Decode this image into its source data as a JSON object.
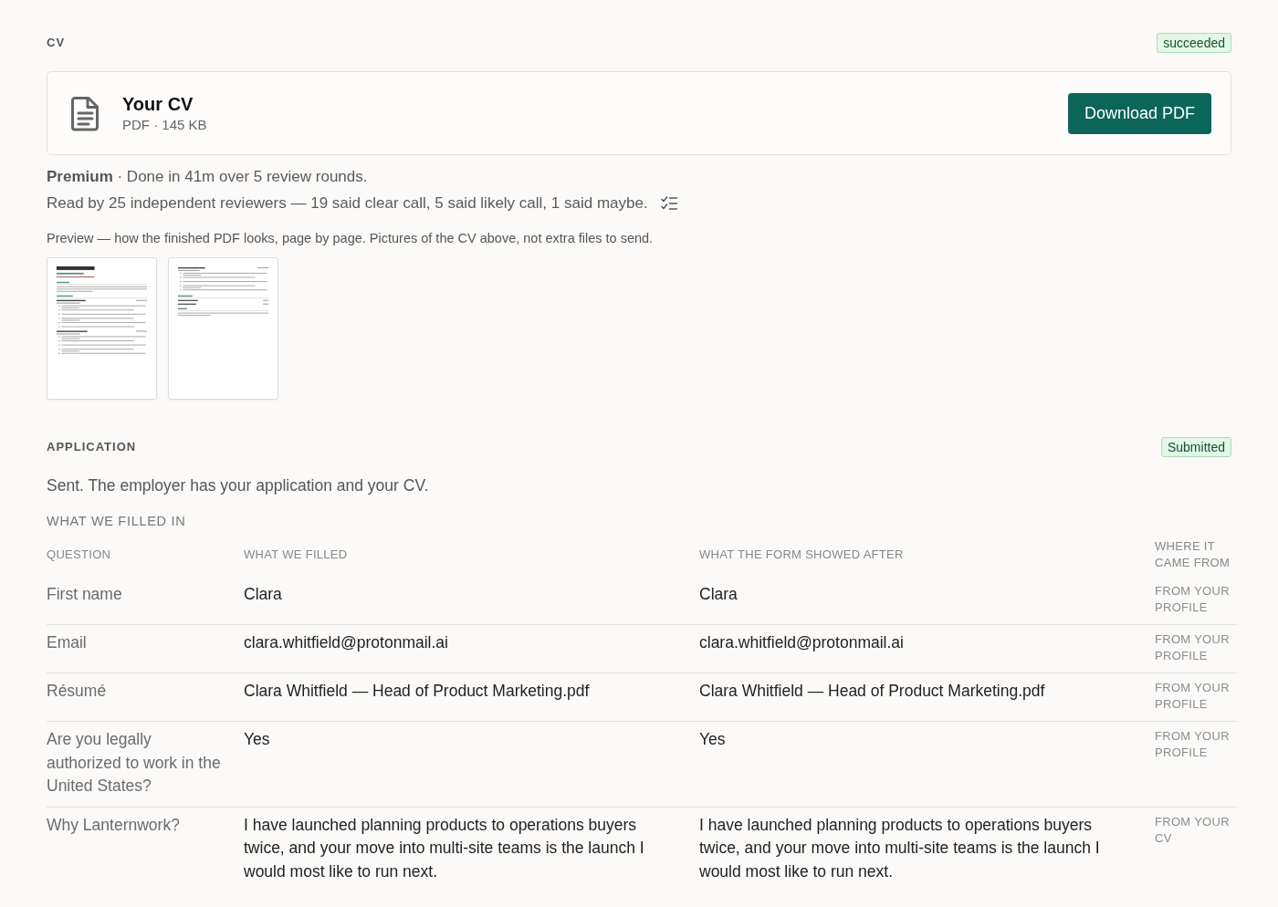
{
  "cv": {
    "heading": "CV",
    "status": {
      "label": "succeeded"
    },
    "file": {
      "title": "Your CV",
      "meta": "PDF · 145 KB",
      "action": "Download PDF"
    },
    "summary": "**Premium** · Done in 41m over 5 review rounds.",
    "reviewers": "Read by 25 independent reviewers — 19 said clear call, 5 said likely call, 1 said maybe.",
    "preview": {
      "caption": "Preview — how the finished PDF looks, page by page. Pictures of the CV above, not extra files to send.",
      "pages": [
        {
          "kind": "first"
        },
        {
          "kind": "continued"
        }
      ]
    }
  },
  "application": {
    "heading": "APPLICATION",
    "status": {
      "label": "Submitted"
    },
    "message": "Sent. The employer has your application and your CV.",
    "filled_heading": "WHAT WE FILLED IN",
    "table": {
      "columns": [
        "QUESTION",
        "WHAT WE FILLED",
        "WHAT THE FORM SHOWED AFTER",
        "WHERE IT CAME FROM"
      ],
      "rows": [
        {
          "question": "First name",
          "filled": "Clara",
          "shown_after": "Clara",
          "source": "FROM YOUR PROFILE"
        },
        {
          "question": "Email",
          "filled": "clara.whitfield@protonmail.ai",
          "shown_after": "clara.whitfield@protonmail.ai",
          "source": "FROM YOUR PROFILE"
        },
        {
          "question": "Résumé",
          "filled": "Clara Whitfield — Head of Product Marketing.pdf",
          "shown_after": "Clara Whitfield — Head of Product Marketing.pdf",
          "source": "FROM YOUR PROFILE"
        },
        {
          "question": "Are you legally authorized to work in the United States?",
          "filled": "Yes",
          "shown_after": "Yes",
          "source": "FROM YOUR PROFILE"
        },
        {
          "question": "Why Lanternwork?",
          "filled": "I have launched planning products to operations buyers twice, and your move into multi-site teams is the launch I would most like to run next.",
          "shown_after": "I have launched planning products to operations buyers twice, and your move into multi-site teams is the launch I would most like to run next.",
          "source": "FROM YOUR CV"
        }
      ]
    }
  }
}
